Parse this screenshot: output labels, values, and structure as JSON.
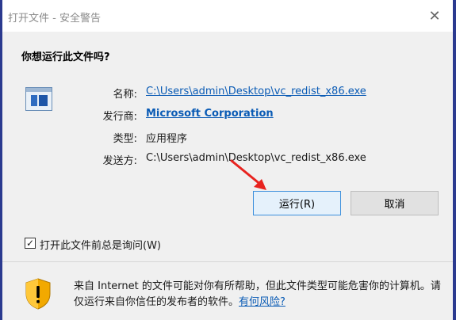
{
  "window": {
    "title": "打开文件 - 安全警告",
    "close_glyph": "✕"
  },
  "question": "你想运行此文件吗?",
  "fields": {
    "name_label": "名称:",
    "name_value": "C:\\Users\\admin\\Desktop\\vc_redist_x86.exe",
    "publisher_label": "发行商:",
    "publisher_value": "Microsoft Corporation",
    "type_label": "类型:",
    "type_value": "应用程序",
    "from_label": "发送方:",
    "from_value": "C:\\Users\\admin\\Desktop\\vc_redist_x86.exe"
  },
  "buttons": {
    "run_label": "运行(R)",
    "cancel_label": "取消"
  },
  "checkbox": {
    "checked": true,
    "mark": "✓",
    "label": "打开此文件前总是询问(W)"
  },
  "warning": {
    "text": "来自 Internet 的文件可能对你有所帮助，但此文件类型可能危害你的计算机。请仅运行来自你信任的发布者的软件。",
    "link": "有何风险?"
  },
  "colors": {
    "link": "#0a5bb5",
    "run_border": "#3c8fdc",
    "annotation_arrow": "#e8231f",
    "shield": "#f2a900"
  },
  "icons": {
    "app": "application-window-icon",
    "shield": "security-shield-warning-icon",
    "close": "close-icon",
    "arrow": "red-annotation-arrow"
  }
}
